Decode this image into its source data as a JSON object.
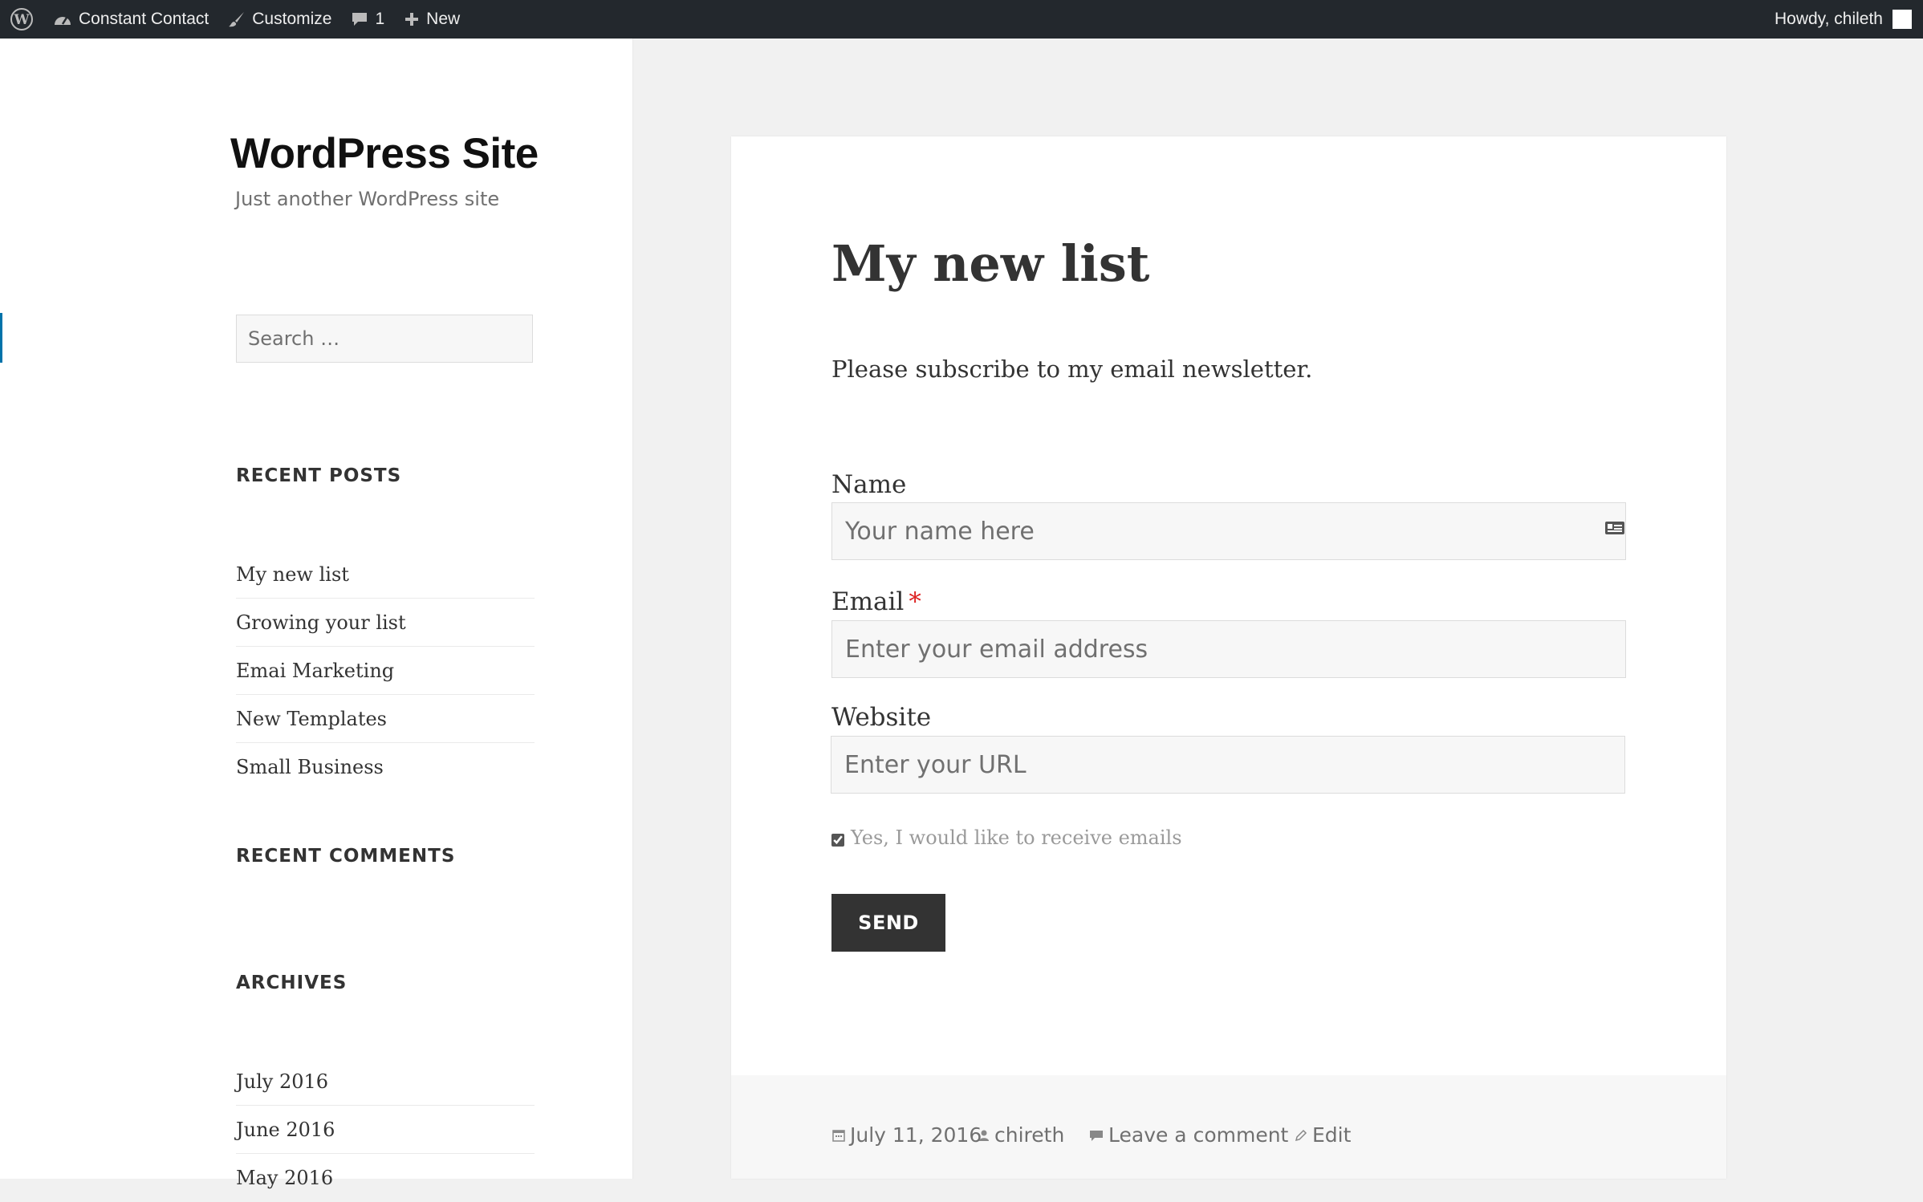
{
  "admin_bar": {
    "site_name": "Constant Contact",
    "customize_label": "Customize",
    "comments_count": "1",
    "new_label": "New",
    "greeting": "Howdy, chileth"
  },
  "sidebar": {
    "site_title": "WordPress Site",
    "site_description": "Just another WordPress site",
    "search_placeholder": "Search …",
    "recent_posts": {
      "title": "RECENT POSTS",
      "items": [
        "My new list",
        "Growing your list",
        "Emai Marketing",
        "New Templates",
        "Small Business"
      ]
    },
    "recent_comments": {
      "title": "RECENT COMMENTS"
    },
    "archives": {
      "title": "ARCHIVES",
      "items": [
        "July 2016",
        "June 2016",
        "May 2016"
      ]
    }
  },
  "article": {
    "title": "My new list",
    "intro": "Please subscribe to my email newsletter.",
    "form": {
      "name_label": "Name",
      "name_placeholder": "Your name here",
      "email_label": "Email",
      "email_required_mark": "*",
      "email_placeholder": "Enter your email address",
      "website_label": "Website",
      "website_placeholder": "Enter your URL",
      "optin_label": "Yes, I would like to receive emails",
      "optin_checked": true,
      "send_label": "SEND"
    },
    "footer": {
      "date": "July 11, 2016",
      "author": "chireth",
      "comments_link": "Leave a comment",
      "edit_link": "Edit"
    }
  },
  "colors": {
    "admin_bar_bg": "#23282d",
    "button_bg": "#333333",
    "required": "#dd2222",
    "accent_marker": "#0073aa"
  }
}
